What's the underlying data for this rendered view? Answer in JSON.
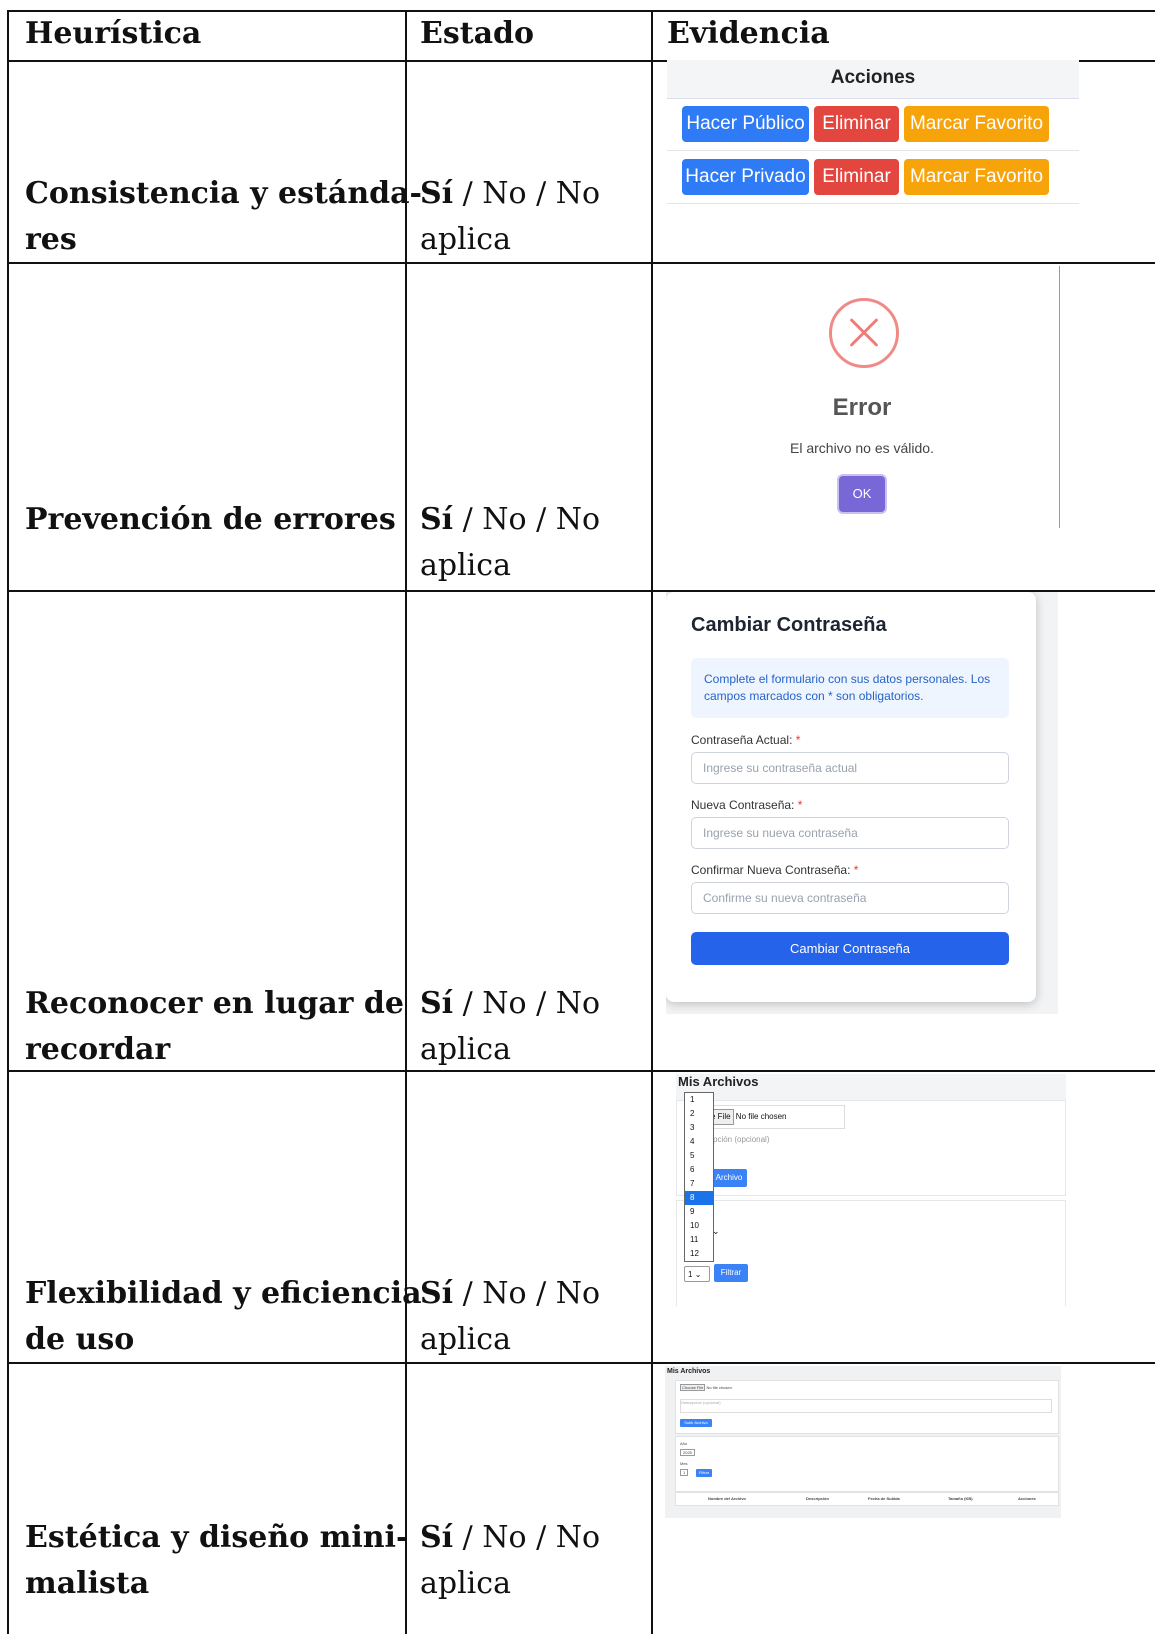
{
  "header": {
    "col1": "Heurística",
    "col2": "Estado",
    "col3": "Evidencia"
  },
  "rows": [
    {
      "heuristic_line1": "Consistencia y estánda-",
      "heuristic_line2": "res",
      "estado_line1_bold": "Sí",
      "estado_line1_rest": " / No / No",
      "estado_line2": "aplica"
    },
    {
      "heuristic_line1": "Prevención de errores",
      "heuristic_line2": "",
      "estado_line1_bold": "Sí",
      "estado_line1_rest": " / No / No",
      "estado_line2": "aplica"
    },
    {
      "heuristic_line1": "Reconocer en lugar de",
      "heuristic_line2": "recordar",
      "estado_line1_bold": "Sí",
      "estado_line1_rest": " / No / No",
      "estado_line2": "aplica"
    },
    {
      "heuristic_line1": "Flexibilidad y eficiencia",
      "heuristic_line2": "de uso",
      "estado_line1_bold": "Sí",
      "estado_line1_rest": " / No / No",
      "estado_line2": "aplica"
    },
    {
      "heuristic_line1": "Estética y diseño mini-",
      "heuristic_line2": "malista",
      "estado_line1_bold": "Sí",
      "estado_line1_rest": " / No / No",
      "estado_line2": "aplica"
    }
  ],
  "ev1": {
    "header": "Acciones",
    "row1": {
      "b1": "Hacer Público",
      "b2": "Eliminar",
      "b3": "Marcar Favorito"
    },
    "row2": {
      "b1": "Hacer Privado",
      "b2": "Eliminar",
      "b3": "Marcar Favorito"
    },
    "colors": {
      "blue": "#2f7bf5",
      "red": "#e3453f",
      "orange": "#f7a30a"
    }
  },
  "ev2": {
    "title": "Error",
    "message": "El archivo no es válido.",
    "ok": "OK",
    "icon": "error-x-icon"
  },
  "ev3": {
    "title": "Cambiar Contraseña",
    "info": "Complete el formulario con sus datos personales. Los campos marcados con * son obligatorios.",
    "fields": [
      {
        "label": "Contraseña Actual:",
        "placeholder": "Ingrese su contraseña actual"
      },
      {
        "label": "Nueva Contraseña:",
        "placeholder": "Ingrese su nueva contraseña"
      },
      {
        "label": "Confirmar Nueva Contraseña:",
        "placeholder": "Confirme su nueva contraseña"
      }
    ],
    "required_mark": "*",
    "submit": "Cambiar Contraseña"
  },
  "ev4": {
    "title": "Mis Archivos",
    "file_btn": "se File",
    "file_status": "No file chosen",
    "desc_placeholder": "pción (opcional)",
    "upload_partial": "Archivo",
    "dropdown_options": [
      "1",
      "2",
      "3",
      "4",
      "5",
      "6",
      "7",
      "8",
      "9",
      "10",
      "11",
      "12"
    ],
    "dropdown_selected": "8",
    "month_value": "1",
    "filter": "Filtrar"
  },
  "ev5": {
    "title": "Mis Archivos",
    "file_btn": "Choose File",
    "file_status": "No file chosen",
    "desc_placeholder": "Descripción (opcional)",
    "upload": "Subir Archivo",
    "year_label": "Año",
    "year_value": "2025",
    "month_label": "Mes",
    "month_value": "1",
    "filter": "Filtrar",
    "columns": [
      "Nombre del Archivo",
      "Descripción",
      "Fecha de Subida",
      "Tamaño (KB)",
      "Acciones"
    ]
  }
}
